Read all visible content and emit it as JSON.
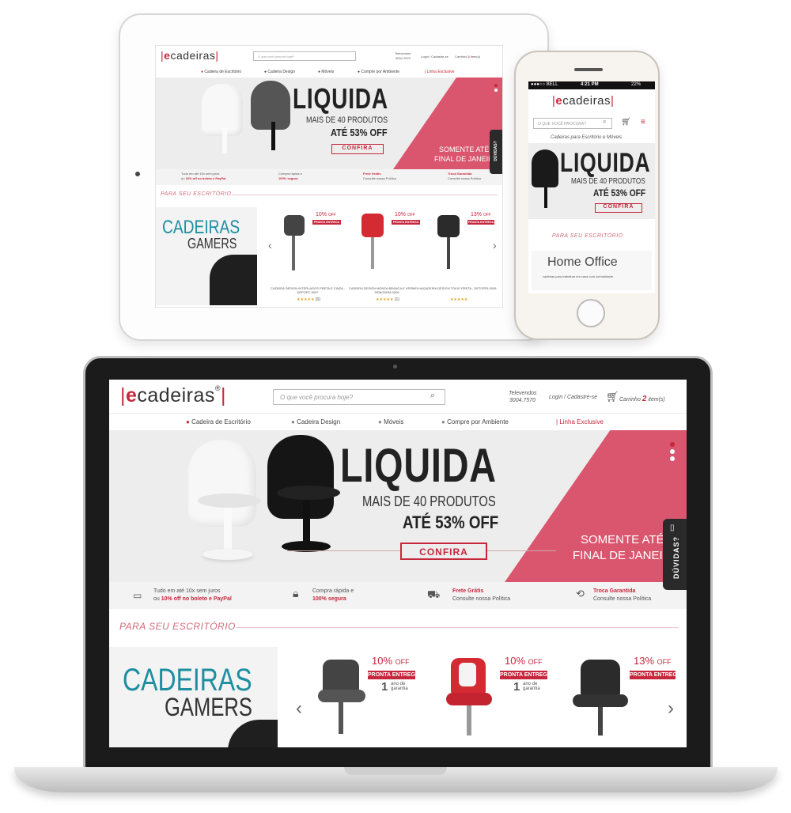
{
  "site": {
    "logo_bar": "|",
    "logo_e": "e",
    "logo_rest": "cadeiras",
    "logo_mark": "®",
    "search_placeholder": "O que você procura hoje?",
    "phone_label": "Televendos",
    "phone_number": "3004.7570",
    "login": "Login / Cadastre-se",
    "cart_label": "Carrinho",
    "cart_count": "2",
    "cart_unit": "item(s)",
    "nav": [
      "Cadeira de Escritório",
      "Cadeira Design",
      "Móveis",
      "Compre por Ambiente"
    ],
    "nav_exclusive": "Linha Exclusive",
    "banner": {
      "title": "LIQUIDA",
      "subtitle": "MAIS DE 40 PRODUTOS",
      "offer": "ATÉ 53% OFF",
      "cta": "CONFIRA",
      "note1": "SOMENTE ATÉ",
      "note2": "FINAL DE JANEIR",
      "note2_short": "FINAL DE JANEI"
    },
    "features": [
      {
        "line1": "Tudo em até 10x sem juros",
        "line2": "ou ",
        "line2b": "10% off no boleto e PayPal"
      },
      {
        "line1": "Compra rápida e",
        "line2b": "100% segura"
      },
      {
        "line1": "Frete Grátis",
        "line2": "Consulte nossa Política"
      },
      {
        "line1": "Troca Garantida",
        "line2": "Consulte nossa Política"
      }
    ],
    "section_title": "PARA SEU ESCRITÓRIO",
    "gamers1": "CADEIRAS",
    "gamers2": "GAMERS",
    "duvidas": "DÚVIDAS?",
    "products": [
      {
        "discount": "10%",
        "off": "OFF",
        "tag": "PRONTA ENTREGA",
        "warranty_n": "1",
        "warranty": "ano de garantia",
        "name": "CADEIRA DESIGN INTERLAGOS PRETA E CINZA - DEPOPC-9007",
        "reviews": "(0)"
      },
      {
        "discount": "10%",
        "off": "OFF",
        "tag": "PRONTA ENTREGA",
        "warranty_n": "1",
        "warranty": "ano de garantia",
        "name": "CADEIRA DESIGN MONZA BRANCA E VERMELHA - DEMODEM-0006",
        "reviews": "(1)"
      },
      {
        "discount": "13%",
        "off": "OFF",
        "tag": "PRONTA ENTREGA",
        "name": "CADEIRA DESIGN TOKIO PRETA - DETOPRI-0005",
        "reviews": ""
      }
    ],
    "stars": "★★★★★"
  },
  "phone": {
    "carrier": "●●●○○ BELL",
    "time": "4:21 PM",
    "battery": "22%",
    "search_placeholder": "O QUE VOCÊ PROCURA?",
    "tagline": "Cadeiras para Escritório e Móveis",
    "home_office1": "Home",
    "home_office2": "Office",
    "home_office_sub": "cadeiras para trabalhar em casa com comodidade"
  },
  "colors": {
    "brand": "#c6273c",
    "banner_pink": "#d9566e",
    "gamers_teal": "#1d8ea0"
  }
}
